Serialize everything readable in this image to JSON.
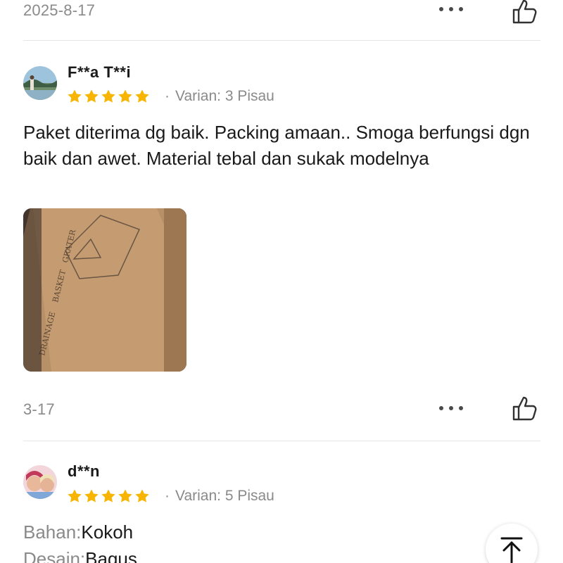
{
  "reviews": [
    {
      "date": "2025-8-17"
    },
    {
      "username": "F**a T**i",
      "rating": 5,
      "variant_prefix": "Varian: 3 Pisau",
      "text": "Paket diterima dg baik. Packing amaan.. Smoga berfungsi dgn baik dan awet. Material tebal dan sukak modelnya",
      "photo_text_1": "DRAINAGE",
      "photo_text_2": "BASKET",
      "photo_text_3": "GRATER",
      "date": "3-17"
    },
    {
      "username": "d**n",
      "rating": 5,
      "variant_prefix": "Varian: 5 Pisau",
      "attributes": [
        {
          "key": "Bahan:",
          "value": "Kokoh"
        },
        {
          "key": "Desain:",
          "value": "Bagus"
        }
      ]
    }
  ],
  "icons": {
    "more": "more-options-icon",
    "like": "thumbs-up-icon",
    "star": "star-icon",
    "back_to_top": "arrow-up-to-top-icon"
  },
  "colors": {
    "star": "#F7B500",
    "muted_text": "#8A8A8A",
    "divider": "#E6E6E6"
  }
}
